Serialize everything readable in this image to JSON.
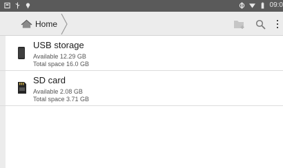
{
  "statusbar": {
    "left_icons": [
      "screenshot-icon",
      "usb-icon",
      "location-icon"
    ],
    "right_icons": [
      "sync-icon",
      "wifi-icon",
      "battery-icon"
    ],
    "time": "09:0"
  },
  "actionbar": {
    "home_label": "Home",
    "actions": [
      "new-folder-icon",
      "search-icon",
      "overflow-menu-icon"
    ]
  },
  "storage": [
    {
      "icon": "usb-storage-icon",
      "title": "USB storage",
      "available": "Available 12.29 GB",
      "total": "Total space 16.0 GB"
    },
    {
      "icon": "sd-card-icon",
      "title": "SD card",
      "available": "Available 2.08 GB",
      "total": "Total space 3.71 GB"
    }
  ]
}
